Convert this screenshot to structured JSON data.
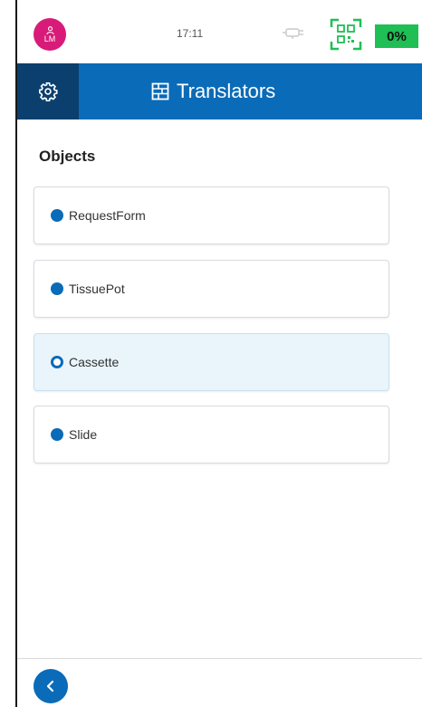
{
  "status_bar": {
    "avatar_initials": "LM",
    "time": "17:11",
    "battery": "0%",
    "icons": [
      "person-icon",
      "cable-icon",
      "qr-code-icon"
    ]
  },
  "header": {
    "title": "Translators",
    "icons": [
      "gear-icon",
      "translators-icon"
    ]
  },
  "section": {
    "title": "Objects"
  },
  "objects": [
    {
      "label": "RequestForm",
      "selected": false
    },
    {
      "label": "TissuePot",
      "selected": false
    },
    {
      "label": "Cassette",
      "selected": true
    },
    {
      "label": "Slide",
      "selected": false
    }
  ],
  "footer": {
    "icons": [
      "chevron-left-icon"
    ]
  },
  "colors": {
    "primary": "#0a6bb8",
    "header_dark": "#0b3f6e",
    "avatar": "#d81b78",
    "battery": "#1fbf55",
    "qr": "#1fbf55",
    "selected_bg": "#e9f4fb"
  }
}
